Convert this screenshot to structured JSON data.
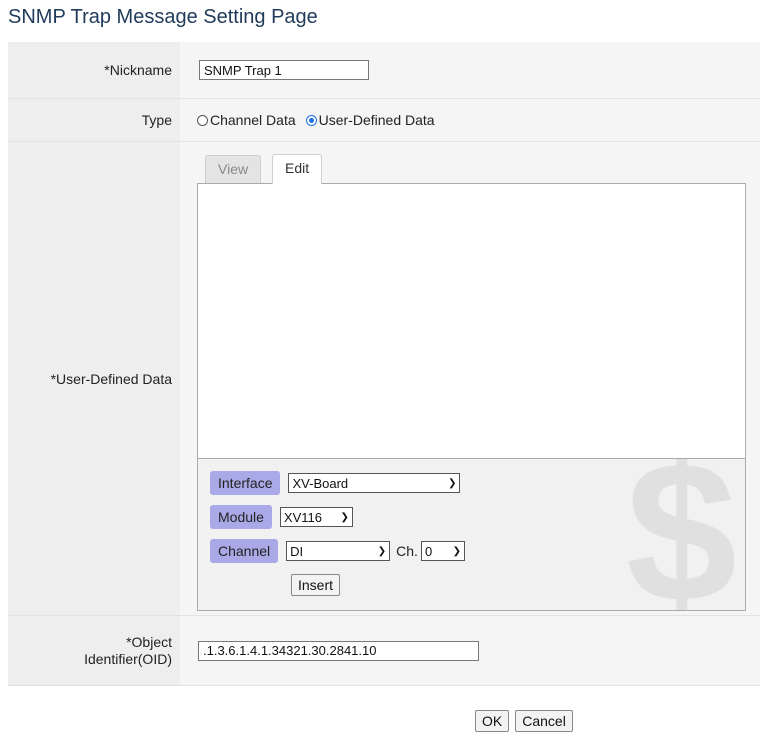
{
  "page": {
    "title": "SNMP Trap Message Setting Page"
  },
  "form": {
    "nickname": {
      "label": "*Nickname",
      "value": "SNMP Trap 1"
    },
    "type": {
      "label": "Type",
      "options": [
        "Channel Data",
        "User-Defined Data"
      ],
      "selected": "User-Defined Data"
    },
    "user_defined": {
      "label": "*User-Defined Data",
      "tabs": [
        "View",
        "Edit"
      ],
      "active_tab": "Edit",
      "text": "",
      "interface": {
        "label": "Interface",
        "value": "XV-Board"
      },
      "module": {
        "label": "Module",
        "value": "XV116"
      },
      "channel": {
        "label": "Channel",
        "value": "DI",
        "ch_label": "Ch.",
        "ch_value": "0"
      },
      "insert_label": "Insert"
    },
    "oid": {
      "label": "*Object Identifier(OID)",
      "value": ".1.3.6.1.4.1.34321.30.2841.10"
    }
  },
  "buttons": {
    "ok": "OK",
    "cancel": "Cancel"
  }
}
